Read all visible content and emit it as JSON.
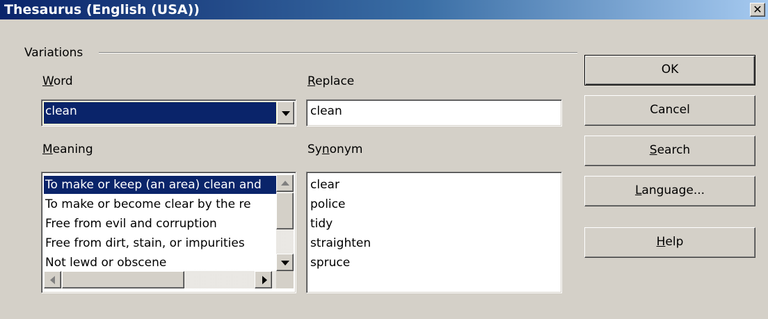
{
  "window": {
    "title": "Thesaurus (English (USA))",
    "close_glyph": "✕"
  },
  "variations": {
    "group_label": "Variations",
    "word": {
      "label_accel": "W",
      "label_rest": "ord",
      "value": "clean"
    },
    "replace": {
      "label_accel": "R",
      "label_rest": "eplace",
      "value": "clean"
    },
    "meaning": {
      "label_accel": "M",
      "label_rest": "eaning",
      "items": [
        "To make or keep (an area) clean and",
        "To make or become clear by the re",
        "Free from evil and corruption",
        "Free from dirt, stain, or impurities",
        "Not lewd or obscene"
      ],
      "selected_index": 0
    },
    "synonym": {
      "label_pre": "Sy",
      "label_accel": "n",
      "label_rest": "onym",
      "items": [
        "clear",
        "police",
        "tidy",
        "straighten",
        "spruce"
      ]
    }
  },
  "buttons": {
    "ok": "OK",
    "cancel": "Cancel",
    "search_accel": "S",
    "search_rest": "earch",
    "language_accel": "L",
    "language_rest": "anguage...",
    "help_accel": "H",
    "help_rest": "elp"
  },
  "colors": {
    "title_start": "#0a246a",
    "title_end": "#a6caf0",
    "selection": "#0a246a",
    "face": "#d4d0c8"
  },
  "icons": {
    "close": "close-icon",
    "combo_arrow": "chevron-down-icon",
    "scroll_up": "scroll-up-arrow-icon",
    "scroll_down": "scroll-down-arrow-icon",
    "scroll_left": "scroll-left-arrow-icon",
    "scroll_right": "scroll-right-arrow-icon"
  }
}
